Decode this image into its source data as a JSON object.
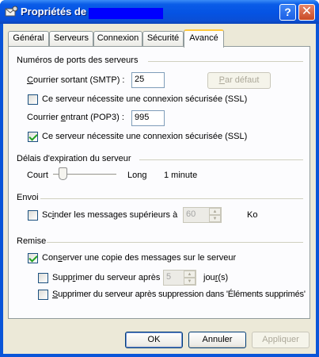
{
  "window": {
    "title": "Propriétés de"
  },
  "tabs": [
    {
      "label": "Général"
    },
    {
      "label": "Serveurs"
    },
    {
      "label": "Connexion"
    },
    {
      "label": "Sécurité"
    },
    {
      "label": "Avancé"
    }
  ],
  "ports": {
    "title": "Numéros de ports des serveurs",
    "smtp_label_u": "C",
    "smtp_label_rest": "ourrier sortant (SMTP) :",
    "smtp_value": "25",
    "default_btn_u": "P",
    "default_btn_rest": "ar défaut",
    "smtp_ssl_label": "Ce serveur nécessite une connexion sécurisée (SSL)",
    "smtp_ssl_checked": false,
    "pop3_label_pre": "Courrier ",
    "pop3_label_u": "e",
    "pop3_label_rest": "ntrant (POP3) :",
    "pop3_value": "995",
    "pop3_ssl_label": "Ce serveur nécessite une connexion sécurisée (SSL)",
    "pop3_ssl_checked": true
  },
  "timeout": {
    "title": "Délais d'expiration du serveur",
    "short_label": "Court",
    "long_label": "Long",
    "value_label": "1 minute",
    "slider_fraction": 0.1
  },
  "send": {
    "title": "Envoi",
    "split_label_pre": "Sc",
    "split_label_u": "i",
    "split_label_rest": "nder les messages supérieurs à",
    "split_checked": false,
    "split_value": "60",
    "split_unit": "Ko"
  },
  "delivery": {
    "title": "Remise",
    "keep_copy_label_pre": "Con",
    "keep_copy_label_u": "s",
    "keep_copy_label_rest": "erver une copie des messages sur le serveur",
    "keep_copy_checked": true,
    "remove_after_label_pre": "Supp",
    "remove_after_label_u": "r",
    "remove_after_label_rest": "imer du serveur après",
    "remove_after_checked": false,
    "remove_after_value": "5",
    "remove_after_unit_pre": "jou",
    "remove_after_unit_u": "r",
    "remove_after_unit_rest": "(s)",
    "remove_deleted_label_u": "S",
    "remove_deleted_label_rest": "upprimer du serveur après suppression dans 'Éléments supprimés'",
    "remove_deleted_checked": false
  },
  "buttons": {
    "ok": "OK",
    "cancel": "Annuler",
    "apply": "Appliquer"
  },
  "colors": {
    "titlebar": "#0553e3",
    "dialog_bg": "#ece9d8",
    "redaction": "#0000ff"
  }
}
